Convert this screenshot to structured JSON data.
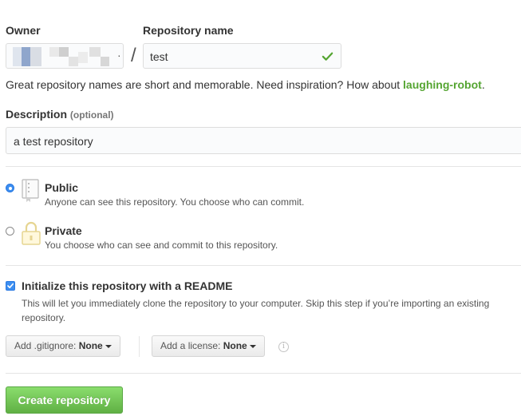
{
  "owner": {
    "label": "Owner",
    "value": "·"
  },
  "separator": "/",
  "repo": {
    "label": "Repository name",
    "value": "test",
    "hint_prefix": "Great repository names are short and memorable. Need inspiration? How about ",
    "suggestion": "laughing-robot",
    "hint_suffix": "."
  },
  "description": {
    "label": "Description",
    "optional": "(optional)",
    "value": "a test repository"
  },
  "visibility": {
    "public": {
      "title": "Public",
      "desc": "Anyone can see this repository. You choose who can commit.",
      "checked": true
    },
    "private": {
      "title": "Private",
      "desc": "You choose who can see and commit to this repository.",
      "checked": false
    }
  },
  "readme": {
    "label": "Initialize this repository with a README",
    "desc": "This will let you immediately clone the repository to your computer. Skip this step if you’re importing an existing repository.",
    "checked": true
  },
  "gitignore": {
    "prefix": "Add .gitignore: ",
    "value": "None"
  },
  "license": {
    "prefix": "Add a license: ",
    "value": "None"
  },
  "info_icon": "i",
  "create_button": "Create repository",
  "colors": {
    "accent_blue": "#3c8ef0",
    "success_green": "#55a532",
    "button_green": "#60b044",
    "lock_yellow": "#e6d592"
  },
  "icons": {
    "check": "check-icon",
    "repo": "repo-book-icon",
    "lock": "lock-icon",
    "caret": "caret-down-icon",
    "info": "info-icon"
  }
}
